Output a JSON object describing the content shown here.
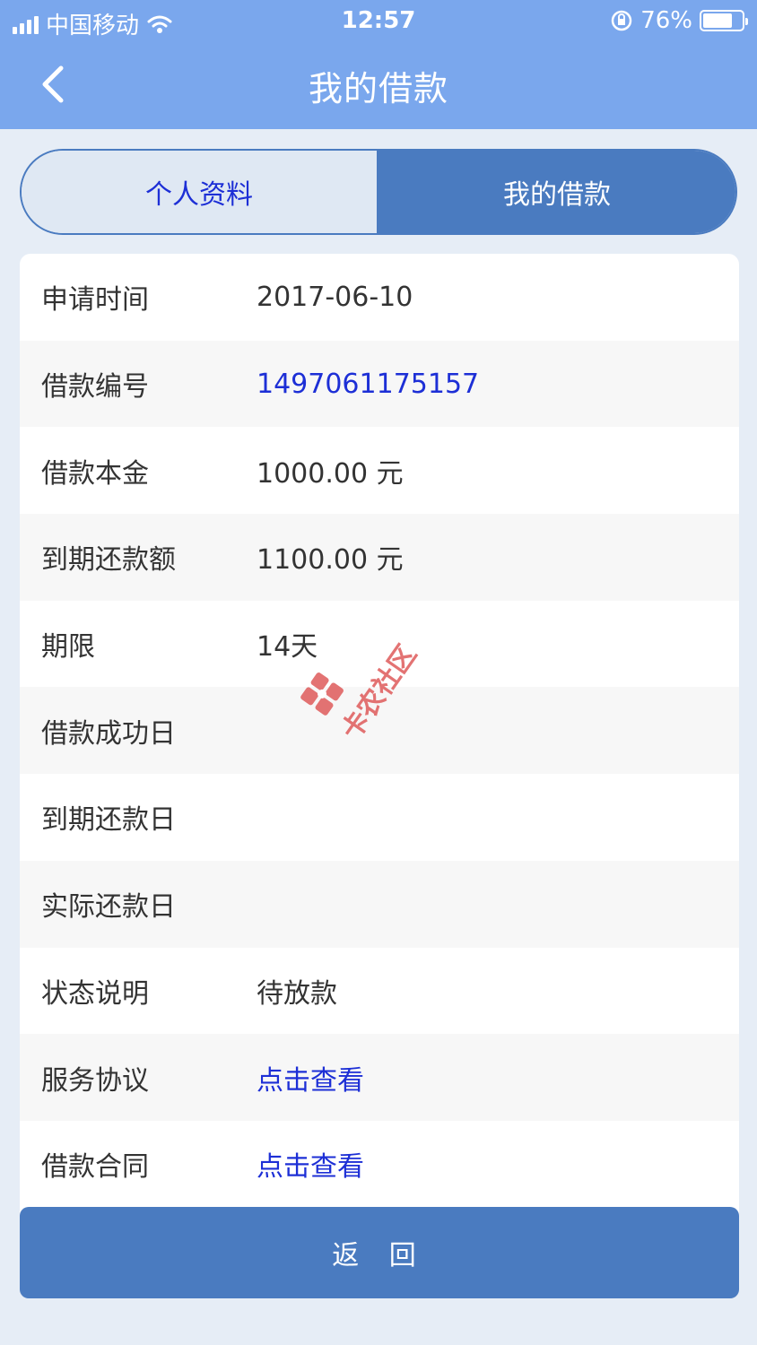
{
  "status_bar": {
    "carrier": "中国移动",
    "time": "12:57",
    "battery_percent": "76%",
    "battery_level": 0.76
  },
  "nav": {
    "title": "我的借款"
  },
  "segment": {
    "tab_profile": "个人资料",
    "tab_loans": "我的借款"
  },
  "details": [
    {
      "label": "申请时间",
      "value": "2017-06-10",
      "link": false
    },
    {
      "label": "借款编号",
      "value": "1497061175157",
      "link": true
    },
    {
      "label": "借款本金",
      "value": "1000.00 元",
      "link": false
    },
    {
      "label": "到期还款额",
      "value": "1100.00 元",
      "link": false
    },
    {
      "label": "期限",
      "value": "14天",
      "link": false
    },
    {
      "label": "借款成功日",
      "value": "",
      "link": false
    },
    {
      "label": "到期还款日",
      "value": "",
      "link": false
    },
    {
      "label": "实际还款日",
      "value": "",
      "link": false
    },
    {
      "label": "状态说明",
      "value": "待放款",
      "link": false
    },
    {
      "label": "服务协议",
      "value": "点击查看",
      "link": true
    },
    {
      "label": "借款合同",
      "value": "点击查看",
      "link": true
    }
  ],
  "watermark_text": "卡农社区",
  "footer": {
    "return_label": "返 回"
  },
  "colors": {
    "header": "#7aa7ed",
    "accent": "#4a7bc0",
    "link": "#1d2fd6"
  }
}
